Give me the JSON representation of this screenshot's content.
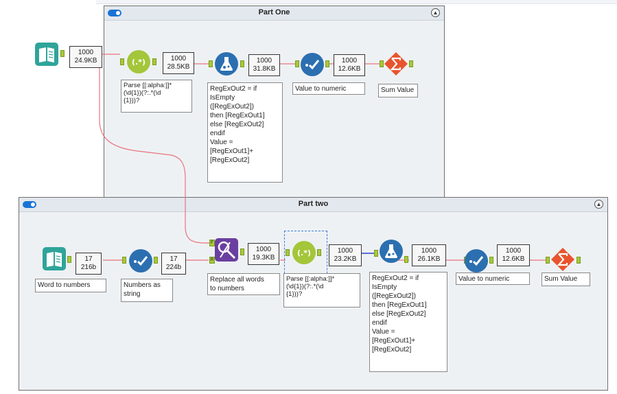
{
  "containers": {
    "part_one": {
      "title": "Part One"
    },
    "part_two": {
      "title": "Part two"
    }
  },
  "colors": {
    "wire_red": "#e8747c",
    "wire_blue": "#2b3fd0",
    "accent": "#1a73d4"
  },
  "icons": {
    "input": "book-icon",
    "parse": "regex-icon",
    "formula": "flask-icon",
    "select": "checkmark-icon",
    "summarize": "sigma-icon",
    "replace": "find-replace-icon"
  },
  "part_one": {
    "input_badge": [
      "1000",
      "24.9KB"
    ],
    "parse_badge": [
      "1000",
      "28.5KB"
    ],
    "formula_badge": [
      "1000",
      "31.8KB"
    ],
    "select_badge": [
      "1000",
      "12.6KB"
    ],
    "parse_annotation": "Parse [[:alpha:]]*\n(\\d{1})(?:.*(\\d\n{1}))?",
    "formula_annotation": "RegExOut2 = if\nIsEmpty\n([RegExOut2])\nthen [RegExOut1]\nelse [RegExOut2]\nendif\nValue =\n[RegExOut1]+\n[RegExOut2]",
    "select_annotation": "Value to numeric",
    "sum_annotation": "Sum Value"
  },
  "part_two": {
    "input_badge": [
      "17",
      "216b"
    ],
    "select1_badge": [
      "17",
      "224b"
    ],
    "replace_badge": [
      "1000",
      "19.3KB"
    ],
    "parse_badge": [
      "1000",
      "23.2KB"
    ],
    "formula_badge": [
      "1000",
      "26.1KB"
    ],
    "select2_badge": [
      "1000",
      "12.6KB"
    ],
    "input_annotation": "Word to numbers",
    "select1_annotation": "Numbers as\nstring",
    "replace_annotation": "Replace all words\nto numbers",
    "parse_annotation": "Parse [[:alpha:]]*\n(\\d{1})(?:.*(\\d\n{1}))?",
    "formula_annotation": "RegExOut2 = if\nIsEmpty\n([RegExOut2])\nthen [RegExOut1]\nelse [RegExOut2]\nendif\nValue =\n[RegExOut1]+\n[RegExOut2]",
    "select2_annotation": "Value to numeric",
    "sum_annotation": "Sum Value",
    "replace_anchor_f": "F",
    "replace_anchor_r": "R"
  }
}
